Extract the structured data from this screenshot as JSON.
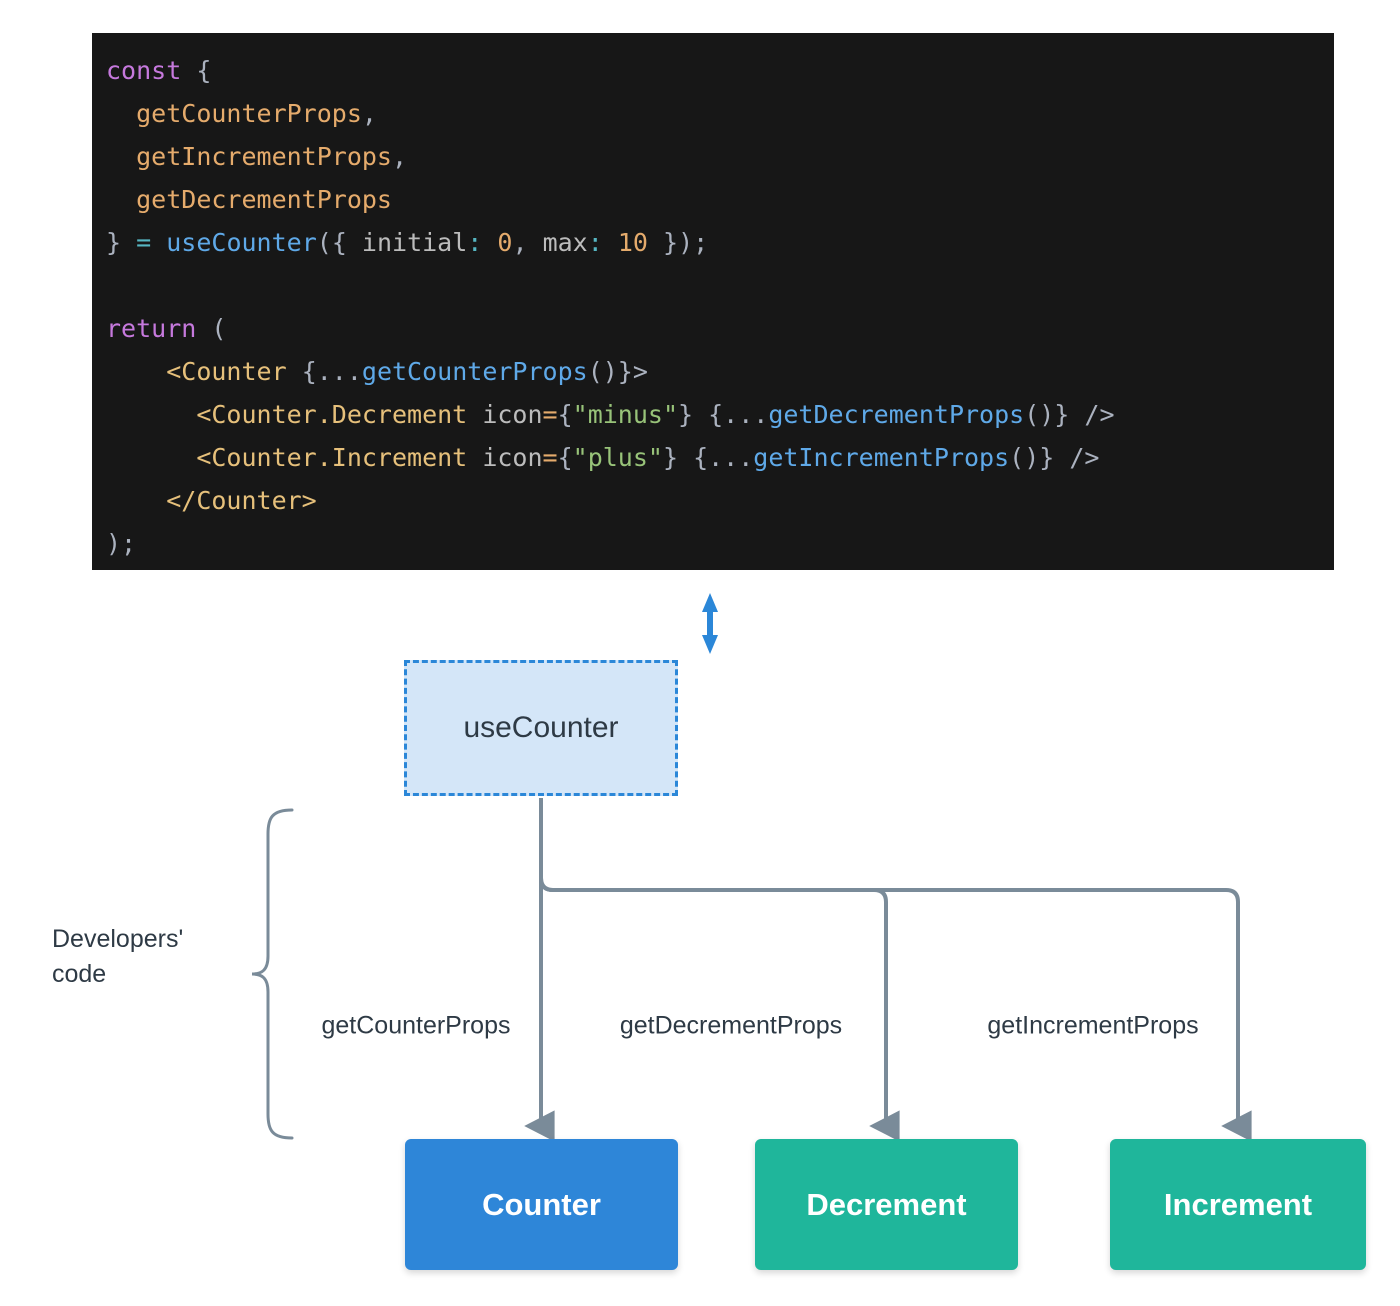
{
  "code": {
    "language": "jsx",
    "background": "#171717",
    "lines": [
      [
        {
          "t": "const",
          "c": "kw"
        },
        {
          "t": " ",
          "c": "plain"
        },
        {
          "t": "{",
          "c": "punct"
        }
      ],
      [
        {
          "t": "  ",
          "c": "plain"
        },
        {
          "t": "getCounterProps",
          "c": "prop"
        },
        {
          "t": ",",
          "c": "punct"
        }
      ],
      [
        {
          "t": "  ",
          "c": "plain"
        },
        {
          "t": "getIncrementProps",
          "c": "prop"
        },
        {
          "t": ",",
          "c": "punct"
        }
      ],
      [
        {
          "t": "  ",
          "c": "plain"
        },
        {
          "t": "getDecrementProps",
          "c": "prop"
        }
      ],
      [
        {
          "t": "}",
          "c": "punct"
        },
        {
          "t": " ",
          "c": "plain"
        },
        {
          "t": "=",
          "c": "op"
        },
        {
          "t": " ",
          "c": "plain"
        },
        {
          "t": "useCounter",
          "c": "fn"
        },
        {
          "t": "({ ",
          "c": "punct"
        },
        {
          "t": "initial",
          "c": "plain"
        },
        {
          "t": ":",
          "c": "op"
        },
        {
          "t": " ",
          "c": "plain"
        },
        {
          "t": "0",
          "c": "num"
        },
        {
          "t": ", ",
          "c": "punct"
        },
        {
          "t": "max",
          "c": "plain"
        },
        {
          "t": ":",
          "c": "op"
        },
        {
          "t": " ",
          "c": "plain"
        },
        {
          "t": "10",
          "c": "num"
        },
        {
          "t": " });",
          "c": "punct"
        }
      ],
      [
        {
          "t": "",
          "c": "plain"
        }
      ],
      [
        {
          "t": "return",
          "c": "kw"
        },
        {
          "t": " ",
          "c": "plain"
        },
        {
          "t": "(",
          "c": "punct"
        }
      ],
      [
        {
          "t": "    ",
          "c": "plain"
        },
        {
          "t": "<Counter",
          "c": "tag"
        },
        {
          "t": " {...",
          "c": "punct"
        },
        {
          "t": "getCounterProps",
          "c": "fn"
        },
        {
          "t": "()}>",
          "c": "punct"
        }
      ],
      [
        {
          "t": "      ",
          "c": "plain"
        },
        {
          "t": "<Counter.Decrement",
          "c": "tag"
        },
        {
          "t": " ",
          "c": "plain"
        },
        {
          "t": "icon",
          "c": "plain"
        },
        {
          "t": "=",
          "c": "prop"
        },
        {
          "t": "{",
          "c": "punct"
        },
        {
          "t": "\"minus\"",
          "c": "str"
        },
        {
          "t": "} {...",
          "c": "punct"
        },
        {
          "t": "getDecrementProps",
          "c": "fn"
        },
        {
          "t": "()} />",
          "c": "punct"
        }
      ],
      [
        {
          "t": "      ",
          "c": "plain"
        },
        {
          "t": "<Counter.Increment",
          "c": "tag"
        },
        {
          "t": " ",
          "c": "plain"
        },
        {
          "t": "icon",
          "c": "plain"
        },
        {
          "t": "=",
          "c": "prop"
        },
        {
          "t": "{",
          "c": "punct"
        },
        {
          "t": "\"plus\"",
          "c": "str"
        },
        {
          "t": "} {...",
          "c": "punct"
        },
        {
          "t": "getIncrementProps",
          "c": "fn"
        },
        {
          "t": "()} />",
          "c": "punct"
        }
      ],
      [
        {
          "t": "    ",
          "c": "plain"
        },
        {
          "t": "</Counter>",
          "c": "tag"
        }
      ],
      [
        {
          "t": ");",
          "c": "punct"
        }
      ]
    ],
    "plain_text": "const {\n  getCounterProps,\n  getIncrementProps,\n  getDecrementProps\n} = useCounter({ initial: 0, max: 10 });\n\nreturn (\n    <Counter {...getCounterProps()}>\n      <Counter.Decrement icon={\"minus\"} {...getDecrementProps()} />\n      <Counter.Increment icon={\"plus\"} {...getIncrementProps()} />\n    </Counter>\n);"
  },
  "diagram": {
    "hook": {
      "label": "useCounter",
      "fill": "#d4e6f8",
      "border": "#2b87d8"
    },
    "bidirectional_arrow": {
      "name": "link-arrow",
      "color": "#2b87d8"
    },
    "brace": {
      "label_line1": "Developers'",
      "label_line2": "code",
      "color": "#7a8b99"
    },
    "edges": [
      {
        "label": "getCounterProps",
        "target": "Counter"
      },
      {
        "label": "getDecrementProps",
        "target": "Decrement"
      },
      {
        "label": "getIncrementProps",
        "target": "Increment"
      }
    ],
    "edge_color": "#7a8b99",
    "components": [
      {
        "label": "Counter",
        "color": "#2e86d8"
      },
      {
        "label": "Decrement",
        "color": "#1fb69b"
      },
      {
        "label": "Increment",
        "color": "#1fb69b"
      }
    ]
  }
}
